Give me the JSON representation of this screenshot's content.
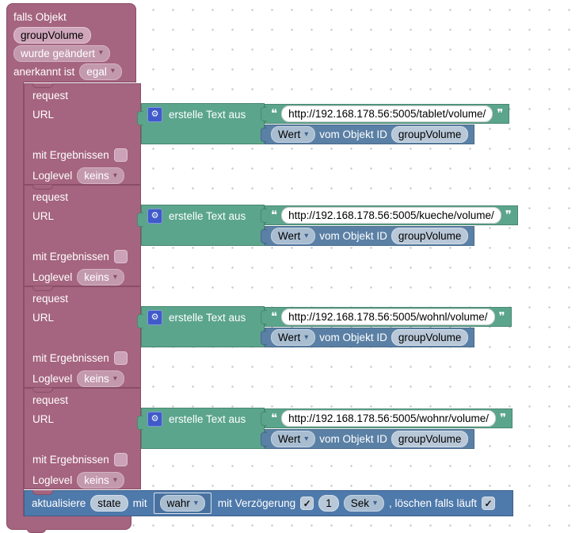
{
  "colors": {
    "trigger_block": "#a5647f",
    "text_block": "#5ba58c",
    "value_block": "#5b80a5",
    "control_block": "#4e79ab",
    "gear_icon_bg": "#3f5ac9"
  },
  "icons": {
    "gear": "⚙",
    "dropdown_arrow": "▾",
    "check": "✓",
    "open_quote": "❝",
    "close_quote": "❞"
  },
  "trigger": {
    "title": "falls Objekt",
    "object_id": "groupVolume",
    "change_dropdown": "wurde geändert",
    "ack_label": "anerkannt ist",
    "ack_dropdown": "egal"
  },
  "request_labels": {
    "name": "request",
    "url": "URL",
    "results": "mit Ergebnissen",
    "loglevel": "Loglevel",
    "loglevel_value": "keins",
    "builder": "erstelle Text aus",
    "value_dropdown": "Wert",
    "value_text": "vom Objekt ID",
    "value_object": "groupVolume"
  },
  "requests": [
    {
      "url": "http://192.168.178.56:5005/tablet/volume/"
    },
    {
      "url": "http://192.168.178.56:5005/kueche/volume/"
    },
    {
      "url": "http://192.168.178.56:5005/wohnl/volume/"
    },
    {
      "url": "http://192.168.178.56:5005/wohnr/volume/"
    }
  ],
  "update": {
    "action": "aktualisiere",
    "state_id": "state",
    "with": "mit",
    "value": "wahr",
    "delay_label": "mit Verzögerung",
    "delay_checked": "✓",
    "delay_value": "1",
    "delay_unit": "Sek",
    "suffix": ", löschen falls läuft",
    "clear_checked": "✓"
  }
}
